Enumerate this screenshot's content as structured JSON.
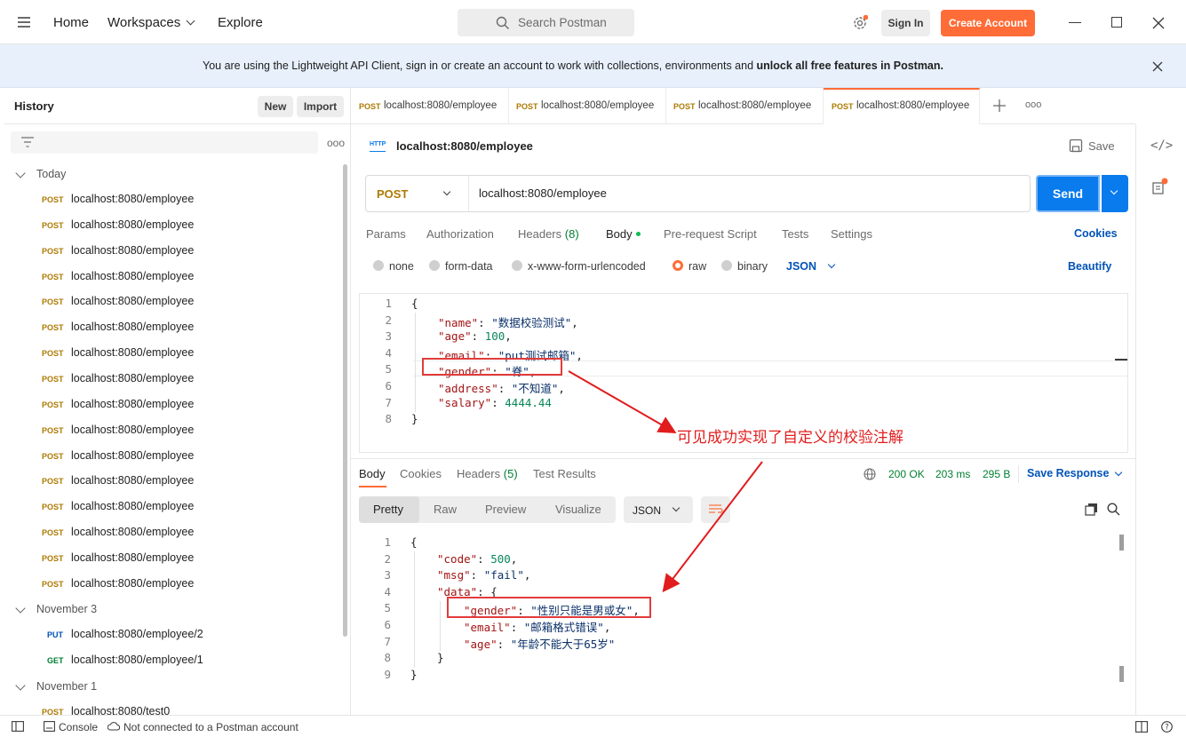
{
  "topbar": {
    "nav": [
      "Home",
      "Workspaces",
      "Explore"
    ],
    "search_placeholder": "Search Postman",
    "signin_label": "Sign In",
    "create_label": "Create Account"
  },
  "banner": {
    "text": "You are using the Lightweight API Client, sign in or create an account to work with collections, environments and ",
    "bold": "unlock all free features in Postman."
  },
  "sidebar": {
    "title": "History",
    "new_label": "New",
    "import_label": "Import",
    "groups": [
      {
        "label": "Today"
      },
      {
        "label": "November 3"
      },
      {
        "label": "November 1"
      }
    ],
    "today_items": [
      {
        "method": "POST",
        "url": "localhost:8080/employee"
      },
      {
        "method": "POST",
        "url": "localhost:8080/employee"
      },
      {
        "method": "POST",
        "url": "localhost:8080/employee"
      },
      {
        "method": "POST",
        "url": "localhost:8080/employee"
      },
      {
        "method": "POST",
        "url": "localhost:8080/employee"
      },
      {
        "method": "POST",
        "url": "localhost:8080/employee"
      },
      {
        "method": "POST",
        "url": "localhost:8080/employee"
      },
      {
        "method": "POST",
        "url": "localhost:8080/employee"
      },
      {
        "method": "POST",
        "url": "localhost:8080/employee"
      },
      {
        "method": "POST",
        "url": "localhost:8080/employee"
      },
      {
        "method": "POST",
        "url": "localhost:8080/employee"
      },
      {
        "method": "POST",
        "url": "localhost:8080/employee"
      },
      {
        "method": "POST",
        "url": "localhost:8080/employee"
      },
      {
        "method": "POST",
        "url": "localhost:8080/employee"
      },
      {
        "method": "POST",
        "url": "localhost:8080/employee"
      },
      {
        "method": "POST",
        "url": "localhost:8080/employee"
      }
    ],
    "nov3_items": [
      {
        "method": "PUT",
        "url": "localhost:8080/employee/2"
      },
      {
        "method": "GET",
        "url": "localhost:8080/employee/1"
      }
    ],
    "nov1_items": [
      {
        "method": "POST",
        "url": "localhost:8080/test0"
      }
    ]
  },
  "tabs": [
    {
      "method": "POST",
      "url": "localhost:8080/employee"
    },
    {
      "method": "POST",
      "url": "localhost:8080/employee"
    },
    {
      "method": "POST",
      "url": "localhost:8080/employee"
    },
    {
      "method": "POST",
      "url": "localhost:8080/employee"
    }
  ],
  "request": {
    "name": "localhost:8080/employee",
    "save_label": "Save",
    "method": "POST",
    "url": "localhost:8080/employee",
    "send_label": "Send",
    "tabs": [
      "Params",
      "Authorization",
      "Headers",
      "Body",
      "Pre-request Script",
      "Tests",
      "Settings"
    ],
    "headers_count": "(8)",
    "cookies_label": "Cookies",
    "body_types": [
      "none",
      "form-data",
      "x-www-form-urlencoded",
      "raw",
      "binary"
    ],
    "format": "JSON",
    "beautify_label": "Beautify",
    "body_lines": [
      {
        "n": "1",
        "t": "{"
      },
      {
        "n": "2",
        "k": "\"name\"",
        "v": "\"数据校验测试\"",
        "vt": "s"
      },
      {
        "n": "3",
        "k": "\"age\"",
        "v": "100",
        "vt": "n"
      },
      {
        "n": "4",
        "k": "\"email\"",
        "v": "\"put测试邮箱\"",
        "vt": "s"
      },
      {
        "n": "5",
        "k": "\"gender\"",
        "v": "\"脊\"",
        "vt": "s"
      },
      {
        "n": "6",
        "k": "\"address\"",
        "v": "\"不知道\"",
        "vt": "s"
      },
      {
        "n": "7",
        "k": "\"salary\"",
        "v": "4444.44",
        "vt": "n"
      },
      {
        "n": "8",
        "t": "}"
      }
    ]
  },
  "response": {
    "tabs": [
      "Body",
      "Cookies",
      "Headers",
      "Test Results"
    ],
    "headers_count": "(5)",
    "status": "200 OK",
    "time": "203 ms",
    "size": "295 B",
    "save_response": "Save Response",
    "views": [
      "Pretty",
      "Raw",
      "Preview",
      "Visualize"
    ],
    "format": "JSON",
    "body_lines": [
      {
        "n": "1",
        "t": "{"
      },
      {
        "n": "2",
        "k": "\"code\"",
        "v": "500",
        "vt": "n"
      },
      {
        "n": "3",
        "k": "\"msg\"",
        "v": "\"fail\"",
        "vt": "s"
      },
      {
        "n": "4",
        "k": "\"data\"",
        "v": "{",
        "vt": "p"
      },
      {
        "n": "5",
        "k": "\"gender\"",
        "v": "\"性别只能是男或女\"",
        "vt": "s"
      },
      {
        "n": "6",
        "k": "\"email\"",
        "v": "\"邮箱格式错误\"",
        "vt": "s"
      },
      {
        "n": "7",
        "k": "\"age\"",
        "v": "\"年龄不能大于65岁\"",
        "vt": "s"
      },
      {
        "n": "8",
        "t": "}"
      },
      {
        "n": "9",
        "t": "}"
      }
    ]
  },
  "annotation": "可见成功实现了自定义的校验注解",
  "statusbar": {
    "console": "Console",
    "connection": "Not connected to a Postman account"
  },
  "colors": {
    "accent": "#ff6c37",
    "send": "#097bed",
    "post": "#ad7a03",
    "put": "#0053b8",
    "get": "#007f31",
    "annotation": "#e11d1d"
  }
}
